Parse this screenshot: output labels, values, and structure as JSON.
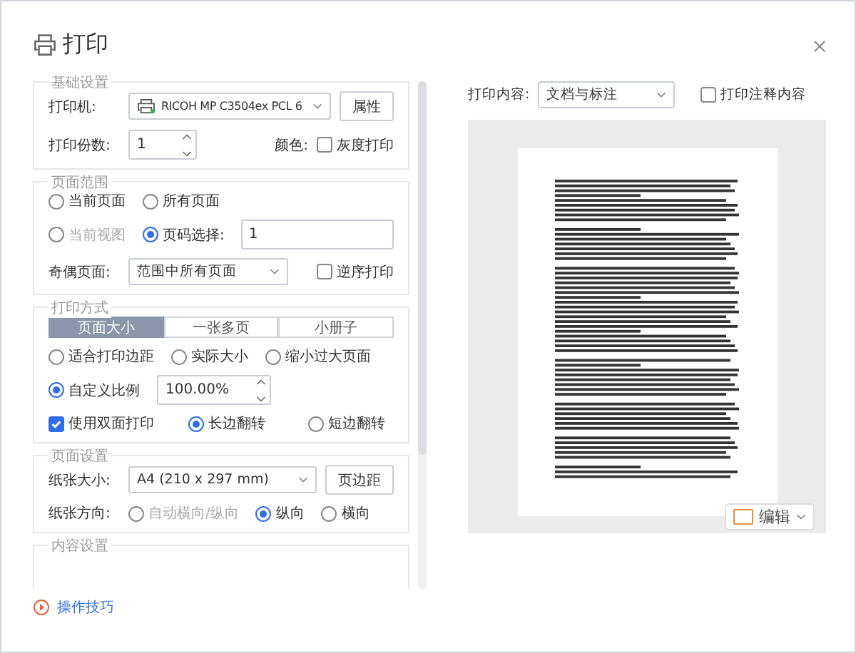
{
  "window": {
    "title": "打印"
  },
  "basic": {
    "title": "基础设置",
    "printer_label": "打印机:",
    "printer": "RICOH MP C3504ex PCL 6",
    "properties_button": "属性",
    "copies_label": "打印份数:",
    "copies": "1",
    "color_label": "颜色:",
    "grayscale": {
      "label": "灰度打印",
      "checked": false
    }
  },
  "range": {
    "title": "页面范围",
    "options": [
      {
        "label": "当前页面",
        "selected": false,
        "disabled": false
      },
      {
        "label": "所有页面",
        "selected": false,
        "disabled": false
      },
      {
        "label": "当前视图",
        "selected": false,
        "disabled": true
      },
      {
        "label": "页码选择:",
        "selected": true,
        "disabled": false
      }
    ],
    "pages_value": "1",
    "odd_even_label": "奇偶页面:",
    "odd_even": "范围中所有页面",
    "reverse": {
      "label": "逆序打印",
      "checked": false
    }
  },
  "mode": {
    "title": "打印方式",
    "tabs": [
      {
        "label": "页面大小",
        "selected": true
      },
      {
        "label": "一张多页",
        "selected": false
      },
      {
        "label": "小册子",
        "selected": false
      }
    ],
    "scale_options": [
      {
        "label": "适合打印边距",
        "selected": false
      },
      {
        "label": "实际大小",
        "selected": false
      },
      {
        "label": "缩小过大页面",
        "selected": false
      },
      {
        "label": "自定义比例",
        "selected": true
      }
    ],
    "scale_value": "100.00%",
    "duplex": {
      "label": "使用双面打印",
      "checked": true
    },
    "flip_options": [
      {
        "label": "长边翻转",
        "selected": true
      },
      {
        "label": "短边翻转",
        "selected": false
      }
    ]
  },
  "page_setup": {
    "title": "页面设置",
    "paper_label": "纸张大小:",
    "paper": "A4 (210 x 297 mm)",
    "margins_button": "页边距",
    "orientation_label": "纸张方向:",
    "orientations": [
      {
        "label": "自动横向/纵向",
        "selected": false,
        "disabled": true
      },
      {
        "label": "纵向",
        "selected": true,
        "disabled": false
      },
      {
        "label": "横向",
        "selected": false,
        "disabled": false
      }
    ]
  },
  "content_setup": {
    "title": "内容设置"
  },
  "tips_link": "操作技巧",
  "preview": {
    "content_label": "打印内容:",
    "content": "文档与标注",
    "annotations": {
      "label": "打印注释内容",
      "checked": false
    },
    "edit_button": "编辑"
  }
}
